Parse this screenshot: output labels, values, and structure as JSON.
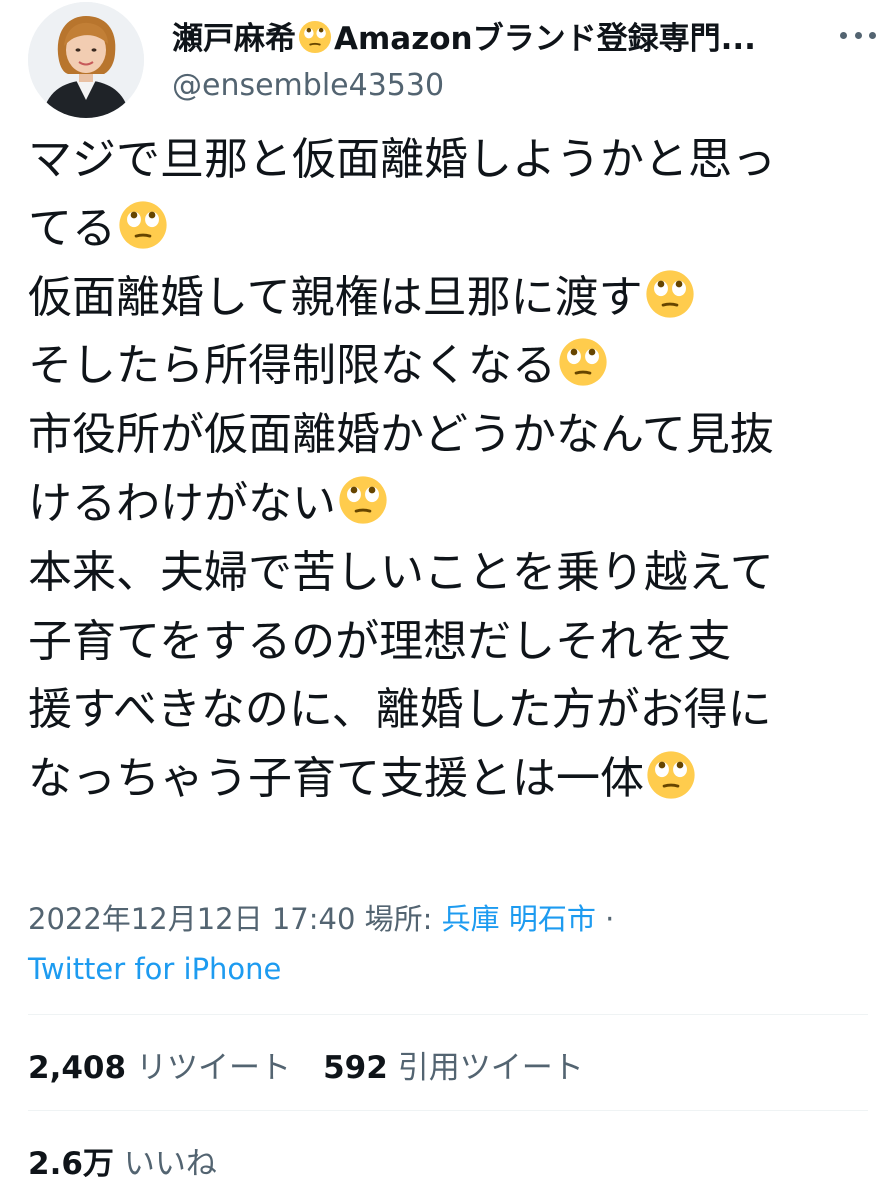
{
  "author": {
    "display_name": "瀬戸麻希",
    "display_name_suffix": "Amazonブランド登録専門...",
    "name_emoji": "face-with-rolling-eyes-emoji",
    "handle": "@ensemble43530"
  },
  "tweet": {
    "lines": [
      {
        "text": "マジで旦那と仮面離婚しようかと思っ",
        "emoji": false
      },
      {
        "text": "てる",
        "emoji": true
      },
      {
        "text": "仮面離婚して親権は旦那に渡す",
        "emoji": true
      },
      {
        "text": "そしたら所得制限なくなる",
        "emoji": true
      },
      {
        "text": "市役所が仮面離婚かどうかなんて見抜",
        "emoji": false
      },
      {
        "text": "けるわけがない",
        "emoji": true
      },
      {
        "text": "本来、夫婦で苦しいことを乗り越えて",
        "emoji": false
      },
      {
        "text": "子育てをするのが理想だしそれを支",
        "emoji": false
      },
      {
        "text": "援すべきなのに、離婚した方がお得に",
        "emoji": false
      },
      {
        "text": "なっちゃう子育て支援とは一体",
        "emoji": true
      }
    ],
    "emoji_icon": "face-with-rolling-eyes-emoji"
  },
  "meta": {
    "timestamp": "2022年12月12日 17:40",
    "place_label": "場所:",
    "place": "兵庫 明石市",
    "separator": "·",
    "source": "Twitter for iPhone"
  },
  "stats": {
    "retweets_count": "2,408",
    "retweets_label": "リツイート",
    "quotes_count": "592",
    "quotes_label": "引用ツイート",
    "likes_count": "2.6万",
    "likes_label": "いいね"
  },
  "colors": {
    "text_primary": "#0f1419",
    "text_secondary": "#536471",
    "link": "#1d9bf0",
    "divider": "#eff3f4",
    "emoji_face": "#ffcc4d"
  }
}
